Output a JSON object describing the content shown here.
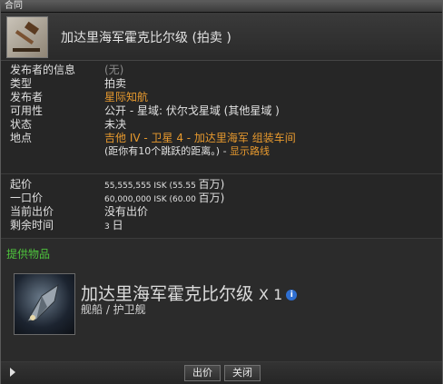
{
  "window": {
    "title": "合同"
  },
  "header": {
    "title": "加达里海军霍克比尔级 (拍卖 )"
  },
  "info": [
    {
      "label": "发布者的信息",
      "value": "(无)",
      "style": "gray"
    },
    {
      "label": "类型",
      "value": "拍卖",
      "style": ""
    },
    {
      "label": "发布者",
      "value": "星际知航",
      "style": "orange"
    },
    {
      "label": "可用性",
      "value": "公开 - 星域: 伏尔戈星域 (其他星域 )",
      "style": ""
    },
    {
      "label": "状态",
      "value": "未决",
      "style": ""
    },
    {
      "label": "地点",
      "value": "吉他 IV - 卫星 4 - 加达里海军 组装车间",
      "style": "orange"
    }
  ],
  "location_extra": {
    "prefix": "(距你有10个跳跃的距离。) - ",
    "link": "显示路线"
  },
  "price": [
    {
      "label": "起价",
      "value": "55,555,555 ISK (55.55 ",
      "unit": "百万)"
    },
    {
      "label": "一口价",
      "value": "60,000,000 ISK (60.00 ",
      "unit": "百万)"
    },
    {
      "label": "当前出价",
      "value": "没有出价",
      "unit": ""
    },
    {
      "label": "剩余时间",
      "value": "3 ",
      "unit": "日"
    }
  ],
  "items_heading": "提供物品",
  "item": {
    "name": "加达里海军霍克比尔级",
    "qty": "X 1",
    "category": "舰船 / 护卫舰",
    "info_icon": "i"
  },
  "buttons": {
    "bid": "出价",
    "close": "关闭"
  }
}
